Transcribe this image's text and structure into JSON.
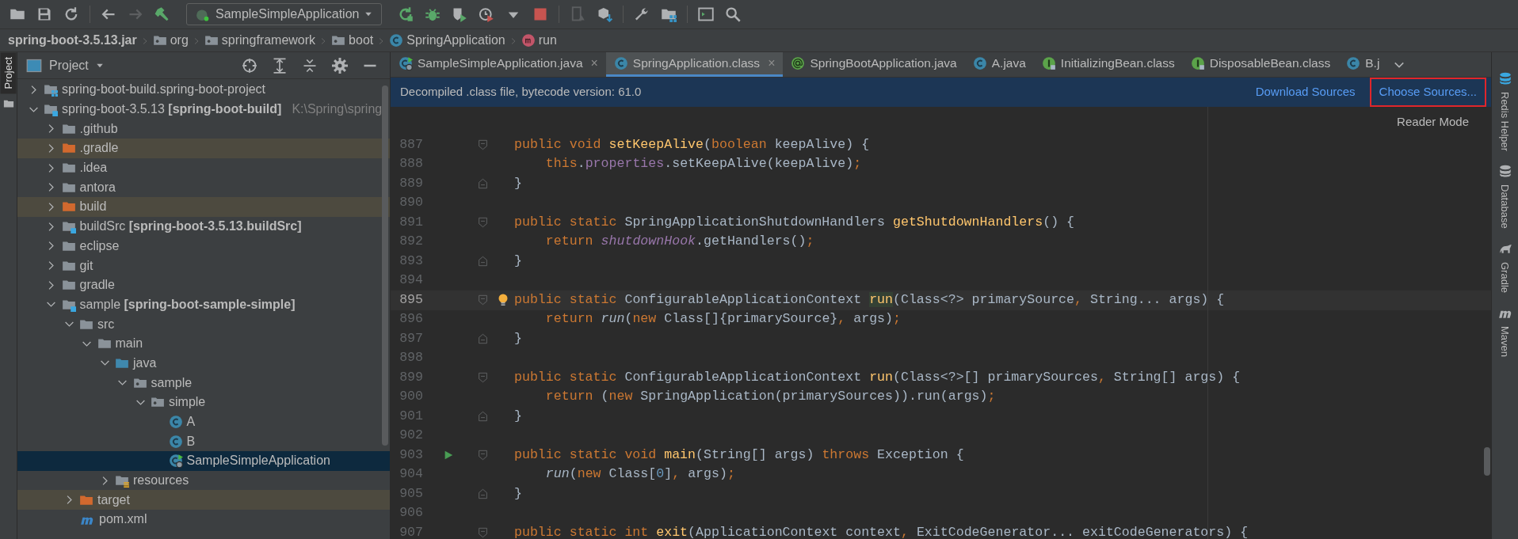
{
  "toolbar": {
    "run_config": "SampleSimpleApplication"
  },
  "breadcrumb": [
    {
      "label": "spring-boot-3.5.13.jar",
      "kind": "jar"
    },
    {
      "label": "org",
      "kind": "package"
    },
    {
      "label": "springframework",
      "kind": "package"
    },
    {
      "label": "boot",
      "kind": "package"
    },
    {
      "label": "SpringApplication",
      "kind": "class"
    },
    {
      "label": "run",
      "kind": "method"
    }
  ],
  "left_stripe": [
    {
      "label": "Project",
      "selected": true
    }
  ],
  "project_panel": {
    "title": "Project",
    "tree": [
      {
        "label": "spring-boot-build.spring-boot-project",
        "kind": "project",
        "expanded": false,
        "selected": false
      },
      {
        "label": "spring-boot-3.5.13 **[spring-boot-build]**",
        "note": "K:\\Spring\\spring",
        "kind": "module",
        "expanded": true,
        "selected": false,
        "children": [
          {
            "label": ".github",
            "kind": "folder",
            "expanded": false,
            "selected": false
          },
          {
            "label": ".gradle",
            "kind": "excluded",
            "expanded": false,
            "selected": false
          },
          {
            "label": ".idea",
            "kind": "folder",
            "expanded": false,
            "selected": false
          },
          {
            "label": "antora",
            "kind": "folder",
            "expanded": false,
            "selected": false
          },
          {
            "label": "build",
            "kind": "excluded",
            "expanded": false,
            "selected": false
          },
          {
            "label": "buildSrc **[spring-boot-3.5.13.buildSrc]**",
            "kind": "module",
            "expanded": false,
            "selected": false
          },
          {
            "label": "eclipse",
            "kind": "folder",
            "expanded": false,
            "selected": false
          },
          {
            "label": "git",
            "kind": "folder",
            "expanded": false,
            "selected": false
          },
          {
            "label": "gradle",
            "kind": "folder",
            "expanded": false,
            "selected": false
          },
          {
            "label": "sample **[spring-boot-sample-simple]**",
            "kind": "module",
            "expanded": true,
            "selected": false,
            "children": [
              {
                "label": "src",
                "kind": "folder",
                "expanded": true,
                "selected": false,
                "children": [
                  {
                    "label": "main",
                    "kind": "folder",
                    "expanded": true,
                    "selected": false,
                    "children": [
                      {
                        "label": "java",
                        "kind": "source",
                        "expanded": true,
                        "selected": false,
                        "children": [
                          {
                            "label": "sample",
                            "kind": "package",
                            "expanded": true,
                            "selected": false,
                            "children": [
                              {
                                "label": "simple",
                                "kind": "package",
                                "expanded": true,
                                "selected": false,
                                "children": [
                                  {
                                    "label": "A",
                                    "kind": "class",
                                    "selected": false
                                  },
                                  {
                                    "label": "B",
                                    "kind": "class",
                                    "selected": false
                                  },
                                  {
                                    "label": "SampleSimpleApplication",
                                    "kind": "main-class",
                                    "selected": true
                                  }
                                ]
                              }
                            ]
                          }
                        ]
                      },
                      {
                        "label": "resources",
                        "kind": "resources",
                        "expanded": false,
                        "selected": false
                      }
                    ]
                  }
                ]
              },
              {
                "label": "target",
                "kind": "excluded",
                "expanded": false,
                "selected": false
              },
              {
                "label": "pom.xml",
                "kind": "maven",
                "selected": false
              }
            ]
          }
        ]
      }
    ]
  },
  "tabs": [
    {
      "label": "SampleSimpleApplication.java",
      "kind": "main-class",
      "selected": false,
      "close": "×"
    },
    {
      "label": "SpringApplication.class",
      "kind": "class",
      "selected": true,
      "close": "×"
    },
    {
      "label": "SpringBootApplication.java",
      "kind": "annotation",
      "selected": false
    },
    {
      "label": "A.java",
      "kind": "class",
      "selected": false
    },
    {
      "label": "InitializingBean.class",
      "kind": "interface",
      "selected": false
    },
    {
      "label": "DisposableBean.class",
      "kind": "interface",
      "selected": false
    },
    {
      "label": "B.j",
      "kind": "class",
      "selected": false
    }
  ],
  "banner": {
    "text": "Decompiled .class file, bytecode version: 61.0",
    "links": [
      {
        "label": "Download Sources",
        "highlighted": false
      },
      {
        "label": "Choose Sources...",
        "highlighted": true
      }
    ]
  },
  "reader_mode": "Reader Mode",
  "code": [
    {
      "number": "887",
      "fold": {
        "kind": "start"
      },
      "current": false,
      "tokens": [
        {
          "text": "public void ",
          "kind": "keyword"
        },
        {
          "text": "setKeepAlive",
          "kind": "decl"
        },
        {
          "text": "(",
          "kind": "plain"
        },
        {
          "text": "boolean ",
          "kind": "keyword"
        },
        {
          "text": "keepAlive) {",
          "kind": "plain"
        }
      ]
    },
    {
      "number": "888",
      "current": false,
      "tokens": [
        {
          "text": "    this",
          "kind": "keyword"
        },
        {
          "text": ".",
          "kind": "plain"
        },
        {
          "text": "properties",
          "kind": "field"
        },
        {
          "text": ".setKeepAlive(keepAlive)",
          "kind": "plain"
        },
        {
          "text": ";",
          "kind": "keyword"
        }
      ]
    },
    {
      "number": "889",
      "fold": {
        "kind": "end"
      },
      "current": false,
      "tokens": [
        {
          "text": "}",
          "kind": "plain"
        }
      ]
    },
    {
      "number": "890",
      "current": false
    },
    {
      "number": "891",
      "fold": {
        "kind": "start"
      },
      "current": false,
      "tokens": [
        {
          "text": "public static ",
          "kind": "keyword"
        },
        {
          "text": "SpringApplicationShutdownHandlers ",
          "kind": "plain"
        },
        {
          "text": "getShutdownHandlers",
          "kind": "decl"
        },
        {
          "text": "() {",
          "kind": "plain"
        }
      ]
    },
    {
      "number": "892",
      "current": false,
      "tokens": [
        {
          "text": "    return ",
          "kind": "keyword"
        },
        {
          "text": "shutdownHook",
          "kind": "static-field"
        },
        {
          "text": ".getHandlers()",
          "kind": "plain"
        },
        {
          "text": ";",
          "kind": "keyword"
        }
      ]
    },
    {
      "number": "893",
      "fold": {
        "kind": "end"
      },
      "current": false,
      "tokens": [
        {
          "text": "}",
          "kind": "plain"
        }
      ]
    },
    {
      "number": "894",
      "current": false
    },
    {
      "number": "895",
      "fold": {
        "kind": "start"
      },
      "mark": {
        "kind": "bulb"
      },
      "current": true,
      "tokens": [
        {
          "text": "public static ",
          "kind": "keyword"
        },
        {
          "text": "ConfigurableApplicationContext ",
          "kind": "plain"
        },
        {
          "text": "run",
          "kind": "decl-match"
        },
        {
          "text": "(Class<?> primarySource",
          "kind": "plain"
        },
        {
          "text": ", ",
          "kind": "keyword"
        },
        {
          "text": "String... args) {",
          "kind": "plain"
        }
      ]
    },
    {
      "number": "896",
      "current": false,
      "tokens": [
        {
          "text": "    return ",
          "kind": "keyword"
        },
        {
          "text": "run",
          "kind": "static-call"
        },
        {
          "text": "(",
          "kind": "plain"
        },
        {
          "text": "new ",
          "kind": "keyword"
        },
        {
          "text": "Class[]{primarySource}",
          "kind": "plain"
        },
        {
          "text": ", ",
          "kind": "keyword"
        },
        {
          "text": "args)",
          "kind": "plain"
        },
        {
          "text": ";",
          "kind": "keyword"
        }
      ]
    },
    {
      "number": "897",
      "fold": {
        "kind": "end"
      },
      "current": false,
      "tokens": [
        {
          "text": "}",
          "kind": "plain"
        }
      ]
    },
    {
      "number": "898",
      "current": false
    },
    {
      "number": "899",
      "fold": {
        "kind": "start"
      },
      "current": false,
      "tokens": [
        {
          "text": "public static ",
          "kind": "keyword"
        },
        {
          "text": "ConfigurableApplicationContext ",
          "kind": "plain"
        },
        {
          "text": "run",
          "kind": "decl"
        },
        {
          "text": "(Class<?>[] primarySources",
          "kind": "plain"
        },
        {
          "text": ", ",
          "kind": "keyword"
        },
        {
          "text": "String[] args) {",
          "kind": "plain"
        }
      ]
    },
    {
      "number": "900",
      "current": false,
      "tokens": [
        {
          "text": "    return ",
          "kind": "keyword"
        },
        {
          "text": "(",
          "kind": "plain"
        },
        {
          "text": "new ",
          "kind": "keyword"
        },
        {
          "text": "SpringApplication(primarySources)).run(args)",
          "kind": "plain"
        },
        {
          "text": ";",
          "kind": "keyword"
        }
      ]
    },
    {
      "number": "901",
      "fold": {
        "kind": "end"
      },
      "current": false,
      "tokens": [
        {
          "text": "}",
          "kind": "plain"
        }
      ]
    },
    {
      "number": "902",
      "current": false
    },
    {
      "number": "903",
      "fold": {
        "kind": "start"
      },
      "mark": {
        "kind": "run"
      },
      "current": false,
      "tokens": [
        {
          "text": "public static void ",
          "kind": "keyword"
        },
        {
          "text": "main",
          "kind": "decl"
        },
        {
          "text": "(String[] args) ",
          "kind": "plain"
        },
        {
          "text": "throws ",
          "kind": "keyword"
        },
        {
          "text": "Exception {",
          "kind": "plain"
        }
      ]
    },
    {
      "number": "904",
      "current": false,
      "tokens": [
        {
          "text": "    run",
          "kind": "static-call"
        },
        {
          "text": "(",
          "kind": "plain"
        },
        {
          "text": "new ",
          "kind": "keyword"
        },
        {
          "text": "Class[",
          "kind": "plain"
        },
        {
          "text": "0",
          "kind": "number"
        },
        {
          "text": "]",
          "kind": "plain"
        },
        {
          "text": ", ",
          "kind": "keyword"
        },
        {
          "text": "args)",
          "kind": "plain"
        },
        {
          "text": ";",
          "kind": "keyword"
        }
      ]
    },
    {
      "number": "905",
      "fold": {
        "kind": "end"
      },
      "current": false,
      "tokens": [
        {
          "text": "}",
          "kind": "plain"
        }
      ]
    },
    {
      "number": "906",
      "current": false
    },
    {
      "number": "907",
      "fold": {
        "kind": "start"
      },
      "current": false,
      "tokens": [
        {
          "text": "public static int ",
          "kind": "keyword"
        },
        {
          "text": "exit",
          "kind": "decl"
        },
        {
          "text": "(ApplicationContext context",
          "kind": "plain"
        },
        {
          "text": ", ",
          "kind": "keyword"
        },
        {
          "text": "ExitCodeGenerator... exitCodeGenerators) {",
          "kind": "plain"
        }
      ]
    }
  ],
  "right_stripe": [
    {
      "label": "Redis Helper",
      "kind": "redis"
    },
    {
      "label": "Database",
      "kind": "database"
    },
    {
      "label": "Gradle",
      "kind": "gradle"
    },
    {
      "label": "Maven",
      "kind": "maven"
    }
  ]
}
